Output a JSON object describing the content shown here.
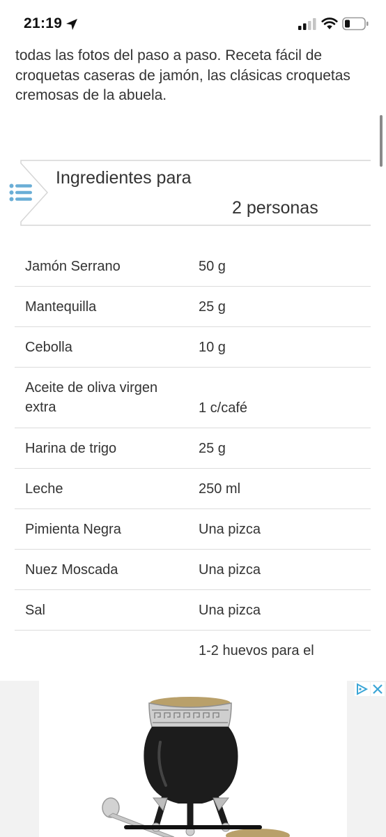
{
  "status_bar": {
    "time": "21:19",
    "icons": [
      "location-arrow-icon",
      "cell-signal-icon",
      "wifi-icon",
      "battery-icon"
    ]
  },
  "intro": {
    "text": "todas las fotos del paso a paso. Receta fácil de croquetas caseras de jamón, las clásicas croquetas cremosas de la abuela."
  },
  "ingredients": {
    "title_line1": "Ingredientes para",
    "title_line2": "2 personas",
    "rows": [
      {
        "name": "Jamón Serrano",
        "qty": "50 g"
      },
      {
        "name": "Mantequilla",
        "qty": "25 g"
      },
      {
        "name": "Cebolla",
        "qty": "10 g"
      },
      {
        "name": "Aceite de oliva virgen extra",
        "qty": "1 c/café"
      },
      {
        "name": "Harina de trigo",
        "qty": "25 g"
      },
      {
        "name": "Leche",
        "qty": "250 ml"
      },
      {
        "name": "Pimienta Negra",
        "qty": "Una pizca"
      },
      {
        "name": "Nuez Moscada",
        "qty": "Una pizca"
      },
      {
        "name": "Sal",
        "qty": "Una pizca"
      },
      {
        "name": "",
        "qty": "1-2 huevos para el"
      }
    ]
  },
  "ad": {
    "icons": [
      "ad-choices-icon",
      "ad-close-icon"
    ],
    "image": "mate-gourd-with-bombilla"
  },
  "colors": {
    "accent_blue": "#6aaed6",
    "divider": "#dcdcdc",
    "text": "#333333"
  }
}
